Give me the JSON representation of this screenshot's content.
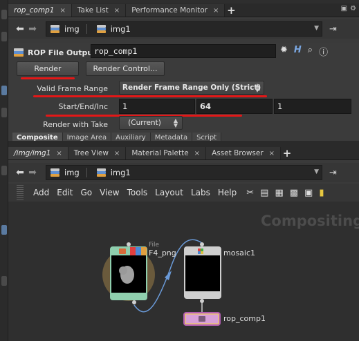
{
  "top_tabs": [
    {
      "label": "rop_comp1",
      "active": true
    },
    {
      "label": "Take List",
      "active": false
    },
    {
      "label": "Performance Monitor",
      "active": false
    }
  ],
  "tab_close": "×",
  "tab_add": "+",
  "path": {
    "context": "img",
    "node": "img1"
  },
  "params": {
    "node_type_label": "ROP File Output",
    "node_name": "rop_comp1",
    "render_button": "Render",
    "render_control_button": "Render Control...",
    "valid_frame_range": {
      "label": "Valid Frame Range",
      "value": "Render Frame Range Only (Strict)"
    },
    "start_end_inc": {
      "label": "Start/End/Inc",
      "start": "1",
      "end": "64",
      "inc": "1"
    },
    "render_with_take": {
      "label": "Render with Take",
      "value": "(Current)"
    },
    "sub_tabs": [
      "Composite",
      "Image Area",
      "Auxiliary",
      "Metadata",
      "Script"
    ]
  },
  "network_tabs": [
    {
      "label": "/img/img1",
      "active": true
    },
    {
      "label": "Tree View",
      "active": false
    },
    {
      "label": "Material Palette",
      "active": false
    },
    {
      "label": "Asset Browser",
      "active": false
    }
  ],
  "network_menu": [
    "Add",
    "Edit",
    "Go",
    "View",
    "Tools",
    "Layout",
    "Labs",
    "Help"
  ],
  "network": {
    "context_label": "Compositing",
    "nodes": [
      {
        "name": "F4_png",
        "type_label": "File"
      },
      {
        "name": "mosaic1"
      },
      {
        "name": "rop_comp1"
      }
    ]
  },
  "colors": {
    "accent_red": "#e41717",
    "file_node_border": "#8fcfae",
    "rop_node_border": "#b05cb0",
    "wire": "#6a9ad8"
  }
}
